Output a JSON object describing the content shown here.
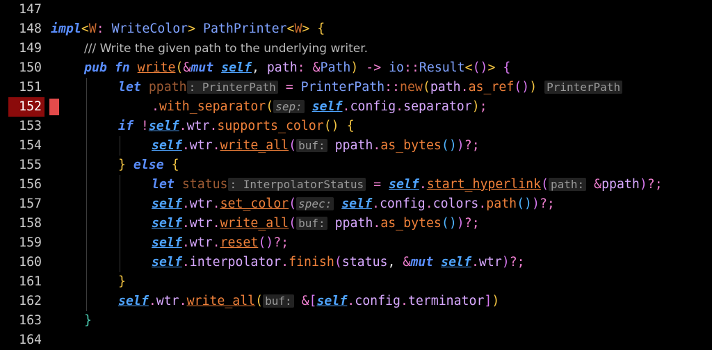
{
  "editor": {
    "current_line": "152",
    "lines": [
      {
        "num": "147"
      },
      {
        "num": "148",
        "t": {
          "a": "impl",
          "b": "<",
          "c": "W",
          "d": ": ",
          "e": "WriteColor",
          "f": "> ",
          "g": "PathPrinter",
          "h": "<",
          "i": "W",
          "j": "> ",
          "k": "{"
        }
      },
      {
        "num": "149",
        "t": {
          "a": "/// Write the given path to the underlying writer."
        }
      },
      {
        "num": "150",
        "t": {
          "a": "pub",
          "b": " ",
          "c": "fn",
          "d": " ",
          "e": "write",
          "f": "(",
          "g": "&",
          "h": "mut",
          "i": " ",
          "j": "self",
          "k": ", ",
          "l": "path",
          "m": ": ",
          "n": "&",
          "o": "Path",
          "p": ")",
          "q": " -> ",
          "r": "io",
          "s": "::",
          "t": "Result",
          "u": "<",
          "v": "()",
          "w": ">",
          "x": " ",
          "y": "{"
        }
      },
      {
        "num": "151",
        "t": {
          "a": "let",
          "b": " ",
          "c": "ppath",
          "d": ": PrinterPath",
          "e": " = ",
          "f": "PrinterPath",
          "g": "::",
          "h": "new",
          "i": "(",
          "j": "path",
          "k": ".",
          "l": "as_ref",
          "m": "()",
          "n": ")",
          "o": " ",
          "p": "PrinterPath"
        }
      },
      {
        "num": "152",
        "t": {
          "a": ".",
          "b": "with_separator",
          "c": "(",
          "d": "sep:",
          "e": " ",
          "f": "self",
          "g": ".",
          "h": "config",
          "i": ".",
          "j": "separator",
          "k": ")",
          "l": ";"
        }
      },
      {
        "num": "153",
        "t": {
          "a": "if",
          "b": " ",
          "c": "!",
          "d": "self",
          "e": ".",
          "f": "wtr",
          "g": ".",
          "h": "supports_color",
          "i": "()",
          "j": " ",
          "k": "{"
        }
      },
      {
        "num": "154",
        "t": {
          "a": "self",
          "b": ".",
          "c": "wtr",
          "d": ".",
          "e": "write_all",
          "f": "(",
          "g": "buf:",
          "h": " ",
          "i": "ppath",
          "j": ".",
          "k": "as_bytes",
          "l": "()",
          "m": ")",
          "n": "?;"
        }
      },
      {
        "num": "155",
        "t": {
          "a": "}",
          "b": " ",
          "c": "else",
          "d": " ",
          "e": "{"
        }
      },
      {
        "num": "156",
        "t": {
          "a": "let",
          "b": " ",
          "c": "status",
          "d": ": InterpolatorStatus",
          "e": " = ",
          "f": "self",
          "g": ".",
          "h": "start_hyperlink",
          "i": "(",
          "j": "path:",
          "k": " ",
          "l": "&",
          "m": "ppath",
          "n": ")",
          "o": "?;"
        }
      },
      {
        "num": "157",
        "t": {
          "a": "self",
          "b": ".",
          "c": "wtr",
          "d": ".",
          "e": "set_color",
          "f": "(",
          "g": "spec:",
          "h": " ",
          "i": "self",
          "j": ".",
          "k": "config",
          "l": ".",
          "m": "colors",
          "n": ".",
          "o": "path",
          "p": "()",
          "q": ")",
          "r": "?;"
        }
      },
      {
        "num": "158",
        "t": {
          "a": "self",
          "b": ".",
          "c": "wtr",
          "d": ".",
          "e": "write_all",
          "f": "(",
          "g": "buf:",
          "h": " ",
          "i": "ppath",
          "j": ".",
          "k": "as_bytes",
          "l": "()",
          "m": ")",
          "n": "?;"
        }
      },
      {
        "num": "159",
        "t": {
          "a": "self",
          "b": ".",
          "c": "wtr",
          "d": ".",
          "e": "reset",
          "f": "()",
          "g": "?;"
        }
      },
      {
        "num": "160",
        "t": {
          "a": "self",
          "b": ".",
          "c": "interpolator",
          "d": ".",
          "e": "finish",
          "f": "(",
          "g": "status",
          "h": ", ",
          "i": "&",
          "j": "mut",
          "k": " ",
          "l": "self",
          "m": ".",
          "n": "wtr",
          "o": ")",
          "p": "?;"
        }
      },
      {
        "num": "161",
        "t": {
          "a": "}"
        }
      },
      {
        "num": "162",
        "t": {
          "a": "self",
          "b": ".",
          "c": "wtr",
          "d": ".",
          "e": "write_all",
          "f": "(",
          "g": "buf:",
          "h": " ",
          "i": "&",
          "j": "[",
          "k": "self",
          "l": ".",
          "m": "config",
          "n": ".",
          "o": "terminator",
          "p": "]",
          "q": ")"
        }
      },
      {
        "num": "163",
        "t": {
          "a": "}"
        }
      },
      {
        "num": "164"
      }
    ]
  },
  "colors": {
    "background": "#000000",
    "current_line_gutter": "#8b0b0b",
    "breakpoint_marker": "#e34b4b",
    "keyword": "#5a8eff",
    "function": "#f0813a",
    "field": "#d8a8ff"
  }
}
